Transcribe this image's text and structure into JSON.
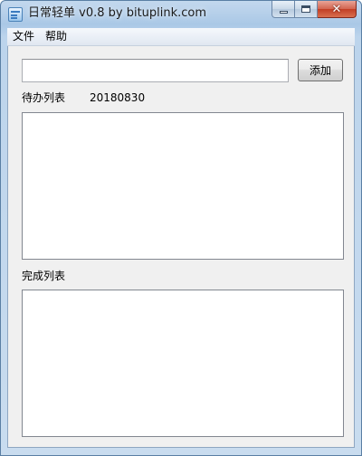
{
  "window": {
    "title": "日常轻单 v0.8 by bituplink.com",
    "icon": "app-icon",
    "controls": [
      "minimize-icon",
      "maximize-icon",
      "close-icon"
    ],
    "close_glyph": "✕"
  },
  "menu": {
    "items": [
      {
        "label": "文件"
      },
      {
        "label": "帮助"
      }
    ]
  },
  "entry": {
    "input_value": "",
    "add_label": "添加"
  },
  "todo": {
    "label": "待办列表",
    "date": "20180830",
    "items": []
  },
  "done": {
    "label": "完成列表",
    "items": []
  },
  "colors": {
    "close_button": "#c23e25",
    "titlebar": "#aac8e6",
    "client_bg": "#f0f0f0"
  }
}
